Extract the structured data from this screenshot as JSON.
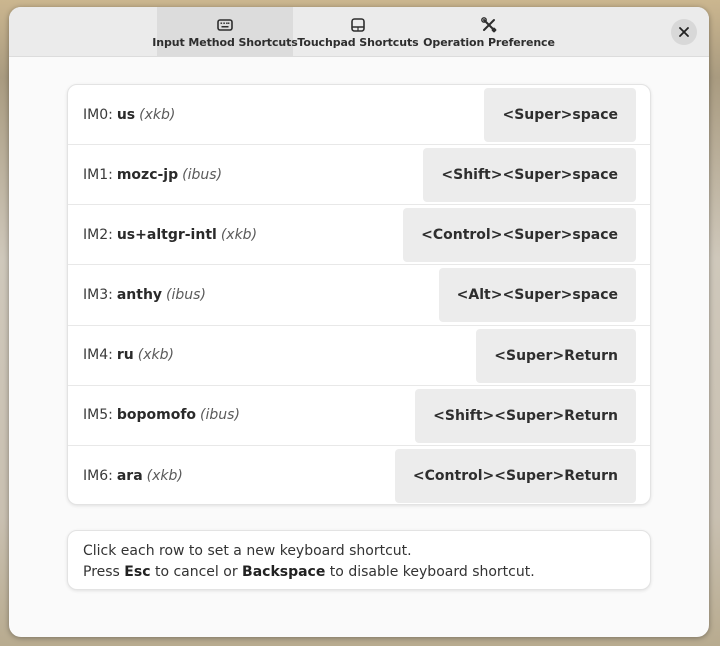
{
  "tabs": [
    {
      "label": "Input Method Shortcuts",
      "icon": "keyboard-icon",
      "active": true
    },
    {
      "label": "Touchpad Shortcuts",
      "icon": "touchpad-icon",
      "active": false
    },
    {
      "label": "Operation Preference",
      "icon": "tools-icon",
      "active": false
    }
  ],
  "close_glyph": "✕",
  "rows": [
    {
      "prefix": "IM0:",
      "name": "us",
      "engine": "xkb",
      "shortcut": "<Super>space"
    },
    {
      "prefix": "IM1:",
      "name": "mozc-jp",
      "engine": "ibus",
      "shortcut": "<Shift><Super>space"
    },
    {
      "prefix": "IM2:",
      "name": "us+altgr-intl",
      "engine": "xkb",
      "shortcut": "<Control><Super>space"
    },
    {
      "prefix": "IM3:",
      "name": "anthy",
      "engine": "ibus",
      "shortcut": "<Alt><Super>space"
    },
    {
      "prefix": "IM4:",
      "name": "ru",
      "engine": "xkb",
      "shortcut": "<Super>Return"
    },
    {
      "prefix": "IM5:",
      "name": "bopomofo",
      "engine": "ibus",
      "shortcut": "<Shift><Super>Return"
    },
    {
      "prefix": "IM6:",
      "name": "ara",
      "engine": "xkb",
      "shortcut": "<Control><Super>Return"
    }
  ],
  "help": {
    "line1": "Click each row to set a new keyboard shortcut.",
    "line2_a": "Press ",
    "esc": "Esc",
    "line2_b": " to cancel or ",
    "backspace": "Backspace",
    "line2_c": " to disable keyboard shortcut."
  }
}
